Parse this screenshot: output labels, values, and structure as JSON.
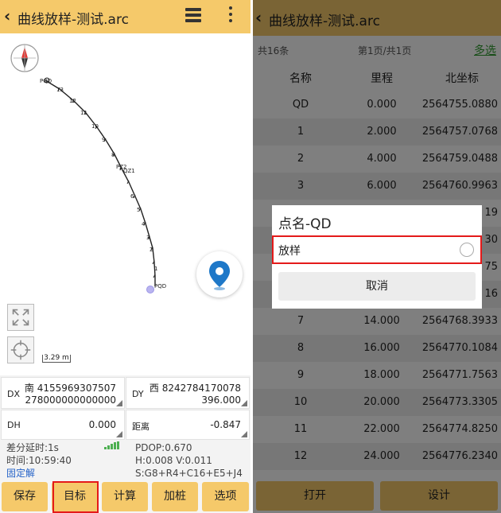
{
  "left": {
    "header": {
      "title": "曲线放样-测试.arc"
    },
    "map": {
      "scale_label": "3.29 m",
      "labels": [
        "PQD",
        "13",
        "12",
        "11",
        "10",
        "9",
        "8",
        "7",
        "PZ2",
        "QZ1",
        "6",
        "5",
        "4",
        "3",
        "2",
        "1",
        "PQD"
      ]
    },
    "info": {
      "dx_label": "DX",
      "dx_value_1": "南 4155969307507",
      "dx_value_2": "278000000000000",
      "dy_label": "DY",
      "dy_value_1": "西 8242784170078",
      "dy_value_2": "396.000",
      "dh_label": "DH",
      "dh_value": "0.000",
      "dist_label": "距离",
      "dist_value": "-0.847"
    },
    "status": {
      "delay": "差分延时:1s",
      "time": "时间:10:59:40",
      "solution": "固定解",
      "pdop": "PDOP:0.670",
      "hv": "H:0.008  V:0.011",
      "sats": "S:G8+R4+C16+E5+J4"
    },
    "buttons": [
      "保存",
      "目标",
      "计算",
      "加桩",
      "选项"
    ]
  },
  "right": {
    "header": {
      "title": "曲线放样-测试.arc"
    },
    "subbar": {
      "total": "共16条",
      "page": "第1页/共1页",
      "multi": "多选"
    },
    "columns": [
      "名称",
      "里程",
      "北坐标"
    ],
    "rows": [
      [
        "QD",
        "0.000",
        "2564755.0880"
      ],
      [
        "1",
        "2.000",
        "2564757.0768"
      ],
      [
        "2",
        "4.000",
        "2564759.0488"
      ],
      [
        "3",
        "6.000",
        "2564760.9963"
      ],
      [
        "",
        "",
        "19"
      ],
      [
        "",
        "",
        "30"
      ],
      [
        "",
        "",
        "75"
      ],
      [
        "",
        "",
        "16"
      ],
      [
        "7",
        "14.000",
        "2564768.3933"
      ],
      [
        "8",
        "16.000",
        "2564770.1084"
      ],
      [
        "9",
        "18.000",
        "2564771.7563"
      ],
      [
        "10",
        "20.000",
        "2564773.3305"
      ],
      [
        "11",
        "22.000",
        "2564774.8250"
      ],
      [
        "12",
        "24.000",
        "2564776.2340"
      ]
    ],
    "footer": {
      "open": "打开",
      "design": "设计"
    },
    "dialog": {
      "title": "点名-QD",
      "option": "放样",
      "cancel": "取消"
    }
  },
  "colors": {
    "accent": "#f5c96a",
    "highlight": "#e41a1a",
    "map_pin": "#1e78c8",
    "multi_select": "#2e9b2e"
  }
}
